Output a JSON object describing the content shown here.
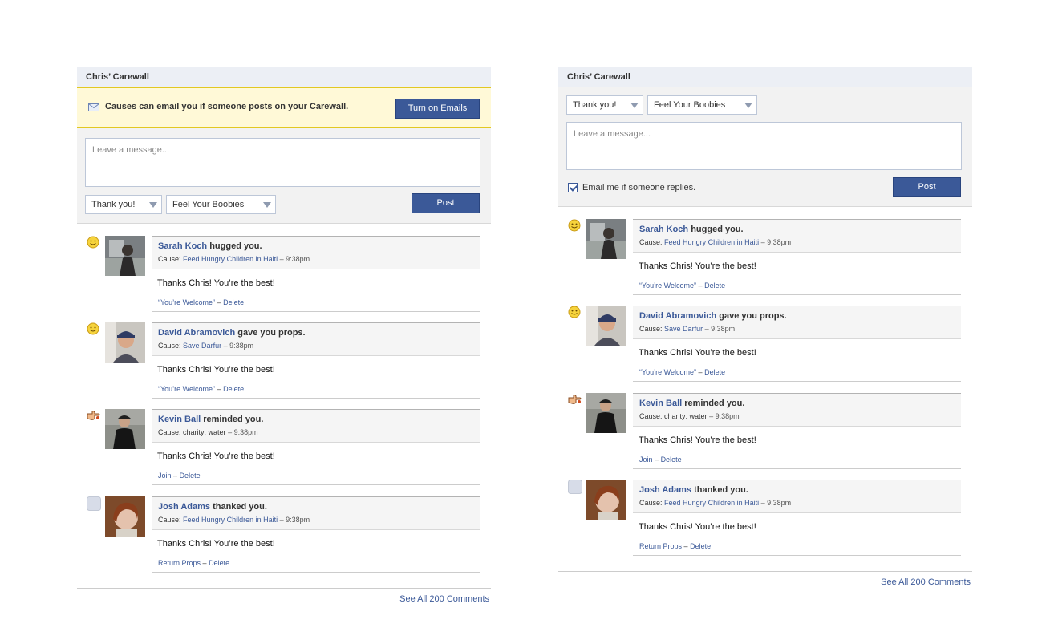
{
  "left": {
    "title": "Chris’ Carewall",
    "notice_text": "Causes can email you if someone posts on your Carewall.",
    "turn_on_label": "Turn on Emails",
    "placeholder": "Leave a message...",
    "select1": "Thank you!",
    "select2": "Feel Your Boobies",
    "post_label": "Post",
    "see_all": "See All 200 Comments"
  },
  "right": {
    "title": "Chris’ Carewall",
    "select1": "Thank you!",
    "select2": "Feel Your Boobies",
    "placeholder": "Leave a message...",
    "email_label": "Email me if someone replies.",
    "post_label": "Post",
    "see_all": "See All 200 Comments"
  },
  "posts": [
    {
      "name": "Sarah Koch",
      "action": "hugged you.",
      "cause_label": "Cause:",
      "cause": "Feed Hungry Children in Haiti",
      "time": "– 9:38pm",
      "text": "Thanks Chris! You’re the best!",
      "reply": "“You’re Welcome”",
      "sep": "–",
      "delete": "Delete",
      "emoji": "smile-icon"
    },
    {
      "name": "David Abramovich",
      "action": "gave you props.",
      "cause_label": "Cause:",
      "cause": "Save Darfur",
      "time": "– 9:38pm",
      "text": "Thanks Chris! You’re the best!",
      "reply": "“You’re Welcome”",
      "sep": "–",
      "delete": "Delete",
      "emoji": "smile-icon"
    },
    {
      "name": "Kevin Ball",
      "action": "reminded you.",
      "cause_label": "Cause: charity: water",
      "cause": "",
      "time": "– 9:38pm",
      "text": "Thanks Chris! You’re the best!",
      "reply": "Join",
      "sep": "–",
      "delete": "Delete",
      "emoji": "pointing-hand-icon"
    },
    {
      "name": "Josh Adams",
      "action": "thanked you.",
      "cause_label": "Cause:",
      "cause": "Feed Hungry Children in Haiti",
      "time": "– 9:38pm",
      "text": "Thanks Chris! You’re the best!",
      "reply": "Return Props",
      "sep": "–",
      "delete": "Delete",
      "emoji": "blank-square-icon"
    }
  ],
  "colors": {
    "accent": "#3b5998",
    "notice_bg": "#fff9d7",
    "title_bg": "#eceff5"
  }
}
